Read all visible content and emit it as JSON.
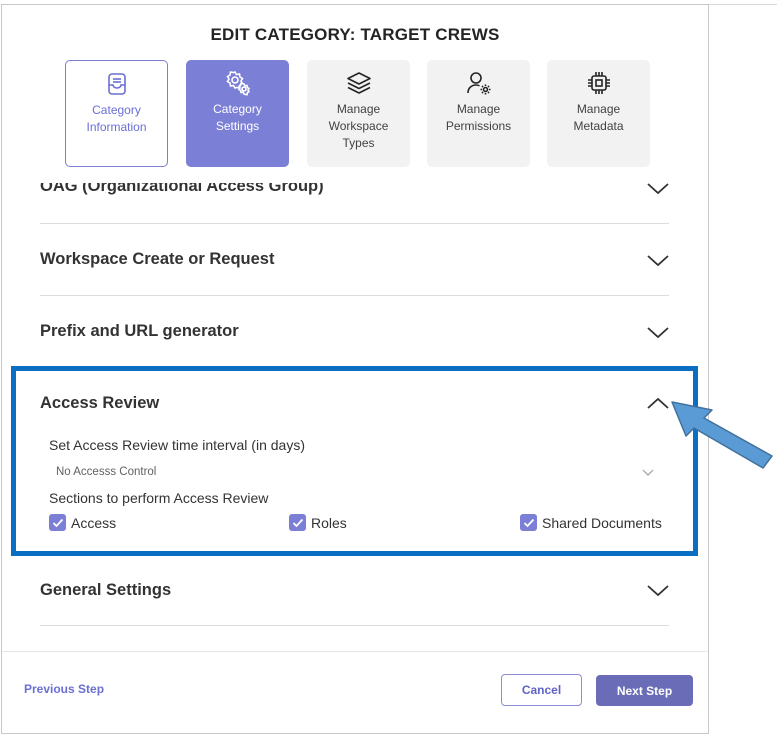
{
  "dialog": {
    "title": "EDIT CATEGORY: TARGET CREWS"
  },
  "steps": [
    {
      "label_line1": "Category",
      "label_line2": "Information",
      "icon": "inbox-icon",
      "state": "done"
    },
    {
      "label_line1": "Category",
      "label_line2": "Settings",
      "icon": "gear-icon",
      "state": "active"
    },
    {
      "label_line1": "Manage",
      "label_line2": "Workspace",
      "label_line3": "Types",
      "icon": "layers-icon",
      "state": "pending"
    },
    {
      "label_line1": "Manage",
      "label_line2": "Permissions",
      "icon": "user-gear-icon",
      "state": "pending"
    },
    {
      "label_line1": "Manage",
      "label_line2": "Metadata",
      "icon": "chip-icon",
      "state": "pending"
    }
  ],
  "sections": {
    "oag": {
      "title": "OAG (Organizational Access Group)"
    },
    "workspace_create": {
      "title": "Workspace Create or Request"
    },
    "prefix_url": {
      "title": "Prefix and URL generator"
    },
    "access_review": {
      "title": "Access Review",
      "interval_label": "Set Access Review time interval (in days)",
      "interval_value": "No Accesss Control",
      "sections_label": "Sections to perform Access Review",
      "checkboxes": [
        {
          "label": "Access",
          "checked": true
        },
        {
          "label": "Roles",
          "checked": true
        },
        {
          "label": "Shared Documents",
          "checked": true
        }
      ]
    },
    "general": {
      "title": "General Settings"
    }
  },
  "footer": {
    "previous_label": "Previous Step",
    "cancel_label": "Cancel",
    "next_label": "Next Step"
  },
  "colors": {
    "accent": "#7b7fd6",
    "primary_button": "#6b6cb8",
    "highlight_border": "#0a6fc2",
    "callout_arrow": "#5b9bd5"
  }
}
